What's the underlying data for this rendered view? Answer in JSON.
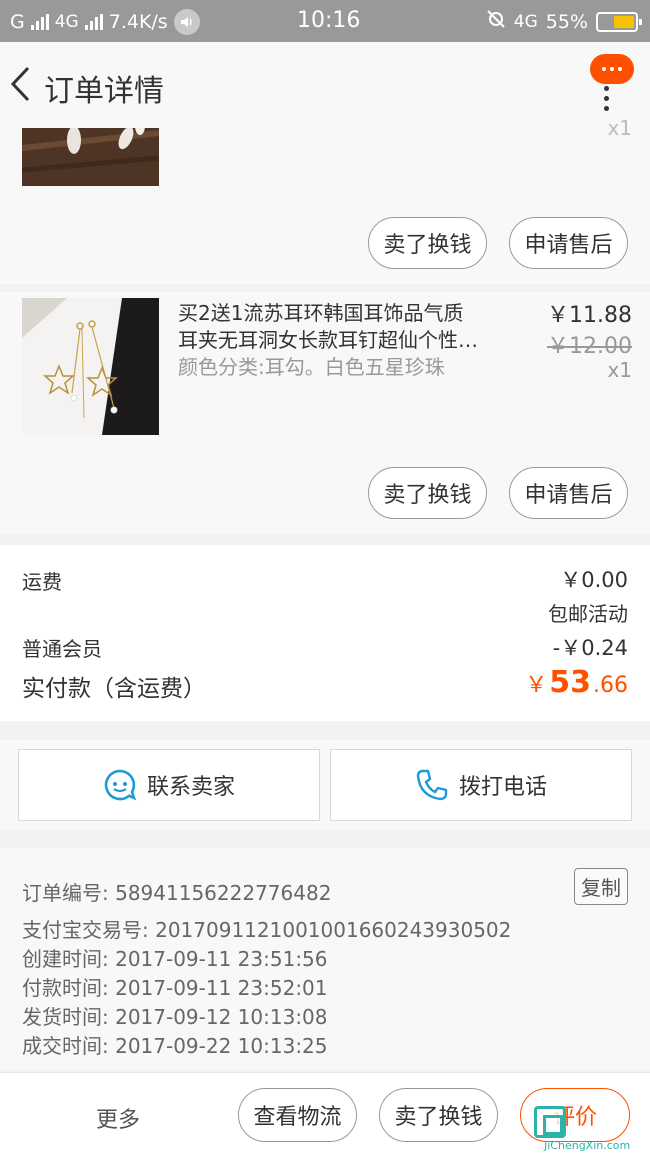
{
  "status_bar": {
    "carrier": "G",
    "network": "4G",
    "speed": "7.4K/s",
    "time": "10:16",
    "network_right": "4G",
    "battery": "55%",
    "battery_level": 0.55
  },
  "nav": {
    "title": "订单详情"
  },
  "item1": {
    "qty": "x1",
    "sell_label": "卖了换钱",
    "aftersale_label": "申请售后"
  },
  "item2": {
    "title_line1": "买2送1流苏耳环韩国耳饰品气质",
    "title_line2": "耳夹无耳洞女长款耳钉超仙个性…",
    "spec": "颜色分类:耳勾。白色五星珍珠",
    "price": "￥11.88",
    "orig_price": "￥12.00",
    "qty": "x1",
    "sell_label": "卖了换钱",
    "aftersale_label": "申请售后"
  },
  "summary": {
    "shipping_label": "运费",
    "shipping_value": "￥0.00",
    "free_shipping": "包邮活动",
    "member_label": "普通会员",
    "member_value": "-￥0.24",
    "total_label": "实付款（含运费）",
    "total_currency": "￥",
    "total_int": "53",
    "total_dec": ".66"
  },
  "contact": {
    "seller": "联系卖家",
    "phone": "拨打电话"
  },
  "order_info": {
    "order_no": "订单编号: 58941156222776482",
    "copy_label": "复制",
    "alipay_no": "支付宝交易号: 2017091121001001660243930502",
    "created": "创建时间: 2017-09-11 23:51:56",
    "paid": "付款时间: 2017-09-11 23:52:01",
    "shipped": "发货时间: 2017-09-12 10:13:08",
    "completed": "成交时间: 2017-09-22 10:13:25"
  },
  "bottom": {
    "more": "更多",
    "logistics": "查看物流",
    "sell": "卖了换钱",
    "review": "评价"
  },
  "watermark": {
    "text": "JiChengXin.com"
  },
  "colors": {
    "accent": "#ff5000",
    "status_bg": "#999999",
    "icon_blue": "#1e9bd7"
  }
}
